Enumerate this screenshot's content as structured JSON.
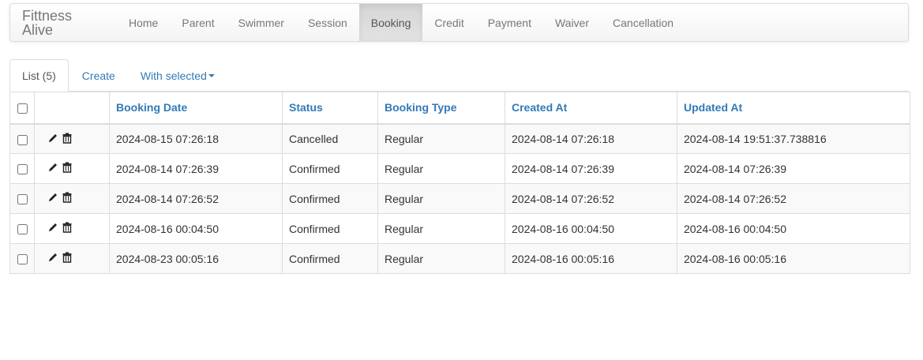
{
  "navbar": {
    "brand": "Fittness Alive",
    "items": [
      {
        "label": "Home",
        "active": false
      },
      {
        "label": "Parent",
        "active": false
      },
      {
        "label": "Swimmer",
        "active": false
      },
      {
        "label": "Session",
        "active": false
      },
      {
        "label": "Booking",
        "active": true
      },
      {
        "label": "Credit",
        "active": false
      },
      {
        "label": "Payment",
        "active": false
      },
      {
        "label": "Waiver",
        "active": false
      },
      {
        "label": "Cancellation",
        "active": false
      }
    ]
  },
  "tabs": {
    "list": "List (5)",
    "create": "Create",
    "with_selected": "With selected"
  },
  "table": {
    "columns": [
      "Booking Date",
      "Status",
      "Booking Type",
      "Created At",
      "Updated At"
    ],
    "rows": [
      [
        "2024-08-15 07:26:18",
        "Cancelled",
        "Regular",
        "2024-08-14 07:26:18",
        "2024-08-14 19:51:37.738816"
      ],
      [
        "2024-08-14 07:26:39",
        "Confirmed",
        "Regular",
        "2024-08-14 07:26:39",
        "2024-08-14 07:26:39"
      ],
      [
        "2024-08-14 07:26:52",
        "Confirmed",
        "Regular",
        "2024-08-14 07:26:52",
        "2024-08-14 07:26:52"
      ],
      [
        "2024-08-16 00:04:50",
        "Confirmed",
        "Regular",
        "2024-08-16 00:04:50",
        "2024-08-16 00:04:50"
      ],
      [
        "2024-08-23 00:05:16",
        "Confirmed",
        "Regular",
        "2024-08-16 00:05:16",
        "2024-08-16 00:05:16"
      ]
    ],
    "row_actions": [
      "pencil-icon",
      "trash-icon"
    ]
  },
  "colors": {
    "link": "#337ab7",
    "nav_text": "#777777",
    "border": "#dddddd",
    "stripe": "#f9f9f9"
  }
}
